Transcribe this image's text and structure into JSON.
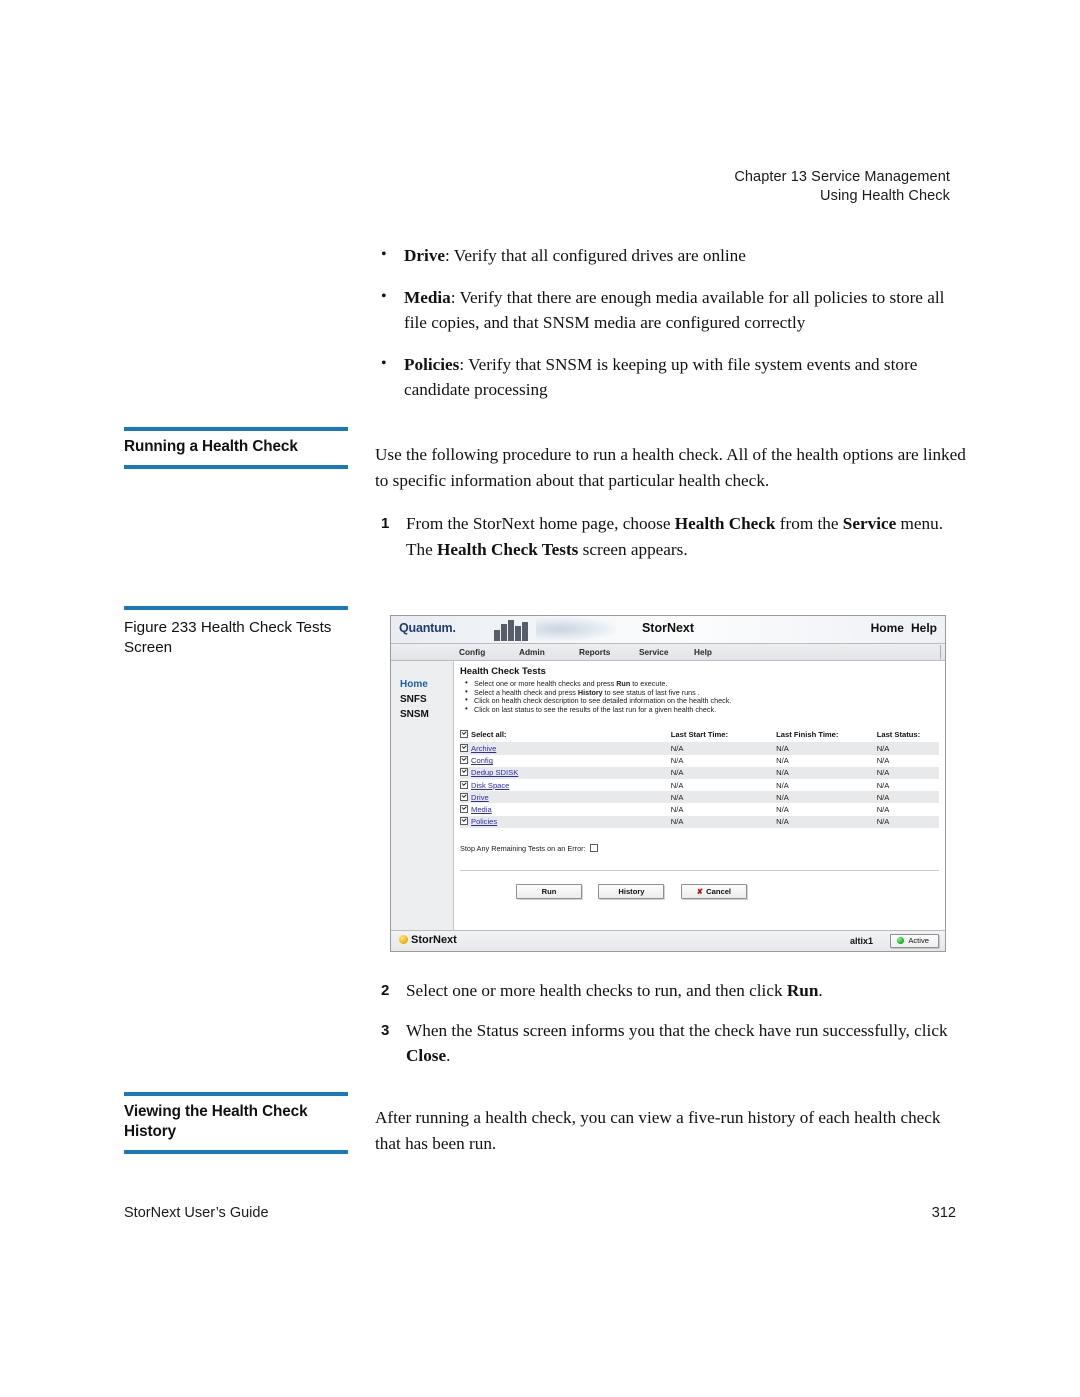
{
  "running_head": {
    "line1": "Chapter 13  Service Management",
    "line2": "Using Health Check"
  },
  "bullets": [
    {
      "term": "Drive",
      "text": ": Verify that all configured drives are online"
    },
    {
      "term": "Media",
      "text": ": Verify that there are enough media available for all policies to store all file copies, and that SNSM media are configured correctly"
    },
    {
      "term": "Policies",
      "text": ": Verify that SNSM is keeping up with file system events and store candidate processing"
    }
  ],
  "sections": {
    "running_a_health_check": {
      "heading": "Running a Health Check",
      "intro": "Use the following procedure to run a health check. All of the health options are linked to specific information about that particular health check.",
      "step1": {
        "num": "1",
        "lead": "From the StorNext home page, choose ",
        "bold1": "Health Check",
        "mid1": " from the ",
        "bold2": "Service",
        "mid2": " menu. The ",
        "bold3": "Health Check Tests",
        "tail": " screen appears."
      },
      "step2": {
        "num": "2",
        "lead": "Select one or more health checks to run, and then click ",
        "bold1": "Run",
        "tail": "."
      },
      "step3": {
        "num": "3",
        "lead": "When the Status screen informs you that the check have run successfully, click ",
        "bold1": "Close",
        "tail": "."
      }
    },
    "viewing_history": {
      "heading": "Viewing the Health Check History",
      "body": "After running a health check, you can view a five-run history of each health check that has been run."
    }
  },
  "figure": {
    "caption": "Figure 233  Health Check Tests Screen"
  },
  "app": {
    "logo": "Quantum.",
    "title": "StorNext",
    "masthead_links": [
      "Home",
      "Help"
    ],
    "menu": [
      "Config",
      "Admin",
      "Reports",
      "Service",
      "Help"
    ],
    "sidebar": [
      "Home",
      "SNFS",
      "SNSM"
    ],
    "page_heading": "Health Check Tests",
    "instructions": [
      {
        "pre": "Select one or more health checks and press ",
        "bold": "Run",
        "post": " to execute."
      },
      {
        "pre": "Select a health check and press ",
        "bold": "History",
        "post": " to see status of last five runs ."
      },
      {
        "pre": "Click on health check description to see detailed information on the health check.",
        "bold": "",
        "post": ""
      },
      {
        "pre": "Click on last status to see the results of the last run for a given health check.",
        "bold": "",
        "post": ""
      }
    ],
    "table": {
      "headers": [
        "Select all:",
        "Last Start Time:",
        "Last Finish Time:",
        "Last Status:"
      ],
      "rows": [
        {
          "name": "Archive",
          "start": "N/A",
          "finish": "N/A",
          "status": "N/A",
          "checked": true
        },
        {
          "name": "Config",
          "start": "N/A",
          "finish": "N/A",
          "status": "N/A",
          "checked": true
        },
        {
          "name": "Dedup SDISK",
          "start": "N/A",
          "finish": "N/A",
          "status": "N/A",
          "checked": true
        },
        {
          "name": "Disk Space",
          "start": "N/A",
          "finish": "N/A",
          "status": "N/A",
          "checked": true
        },
        {
          "name": "Drive",
          "start": "N/A",
          "finish": "N/A",
          "status": "N/A",
          "checked": true
        },
        {
          "name": "Media",
          "start": "N/A",
          "finish": "N/A",
          "status": "N/A",
          "checked": true
        },
        {
          "name": "Policies",
          "start": "N/A",
          "finish": "N/A",
          "status": "N/A",
          "checked": true
        }
      ]
    },
    "stop_on_error_label": "Stop Any Remaining Tests on an Error:",
    "buttons": {
      "run": "Run",
      "history": "History",
      "cancel": "Cancel",
      "cancel_mark": "✘"
    },
    "statusbar": {
      "brand": "StorNext",
      "host": "altix1",
      "state": "Active"
    }
  },
  "page_footer": {
    "left": "StorNext User’s Guide",
    "right": "312"
  },
  "colors": {
    "rule_blue": "#1879be",
    "link_blue": "#2b2bb5",
    "active_green": "#17b81f"
  }
}
